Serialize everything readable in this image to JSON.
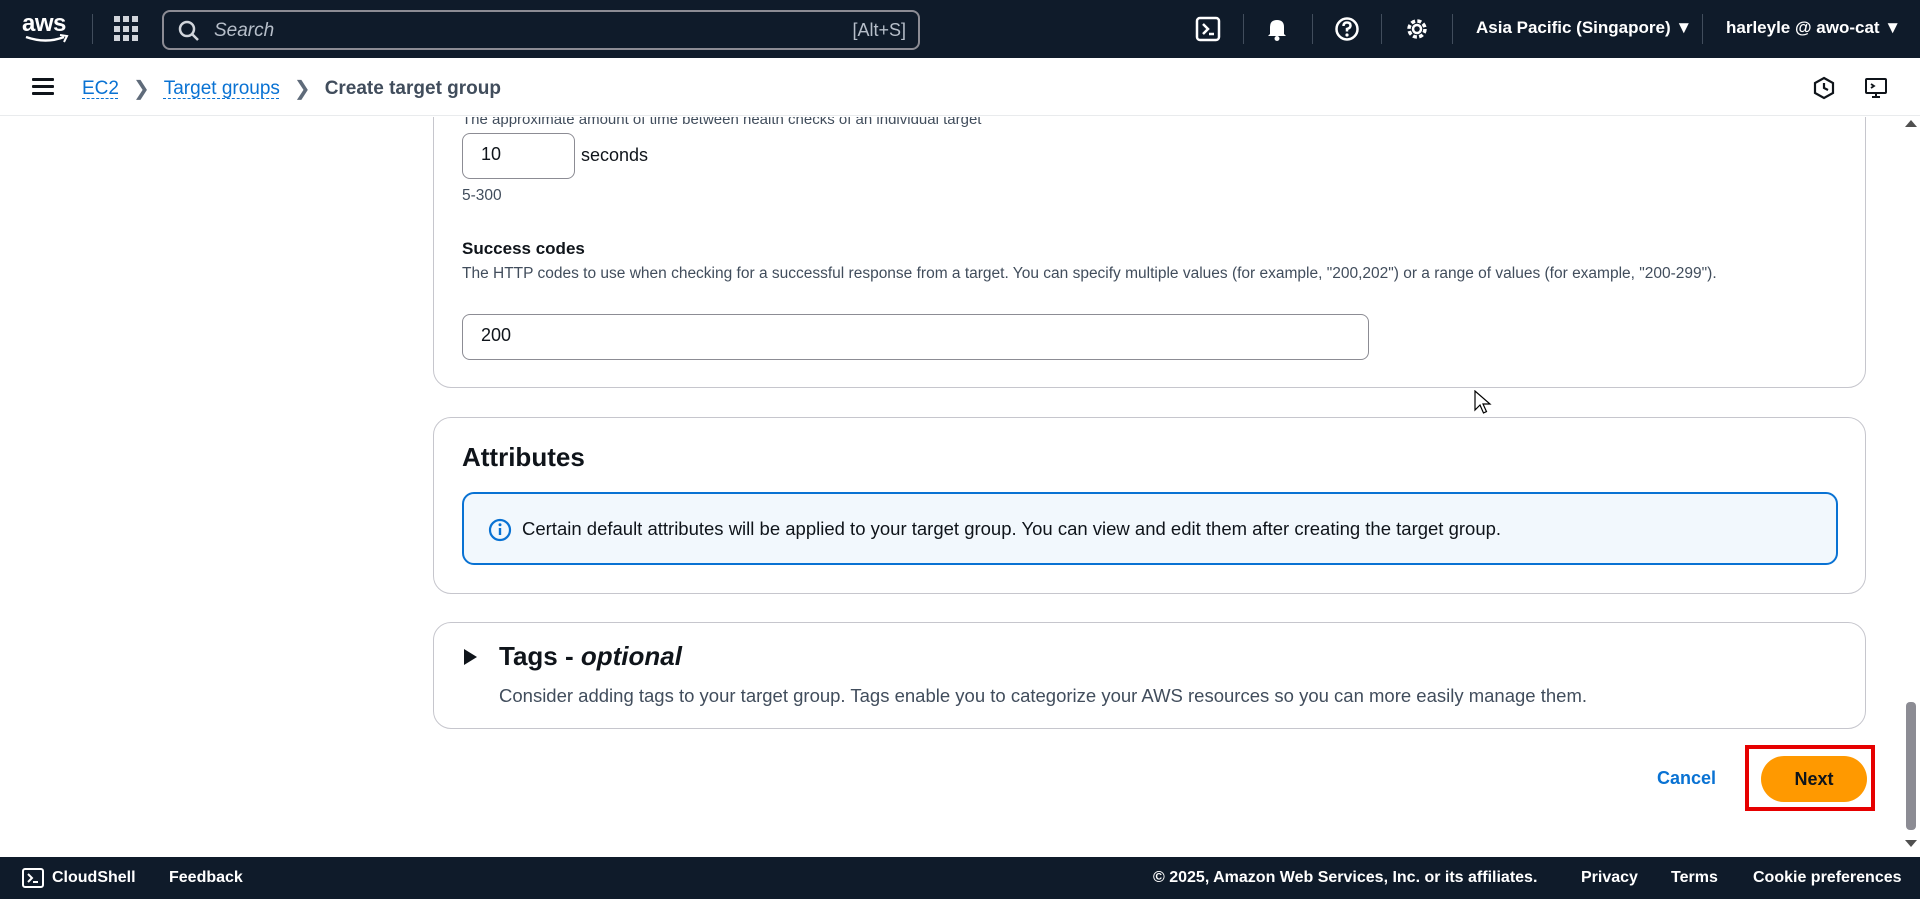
{
  "topnav": {
    "logo_text": "aws",
    "search_placeholder": "Search",
    "search_shortcut": "[Alt+S]",
    "region": "Asia Pacific (Singapore) ▼",
    "user": "harleyle @ awo-cat ▼",
    "icons": [
      "cloudshell-icon",
      "bell-icon",
      "help-icon",
      "gear-icon"
    ]
  },
  "breadcrumb": {
    "items": [
      "EC2",
      "Target groups"
    ],
    "current": "Create target group"
  },
  "health_check": {
    "interval_desc": "The approximate amount of time between health checks of an individual target",
    "interval_value": "10",
    "interval_unit": "seconds",
    "interval_range": "5-300",
    "success_codes_label": "Success codes",
    "success_codes_desc": "The HTTP codes to use when checking for a successful response from a target. You can specify multiple values (for example, \"200,202\") or a range of values (for example, \"200-299\").",
    "success_codes_value": "200"
  },
  "attributes": {
    "title": "Attributes",
    "info": "Certain default attributes will be applied to your target group. You can view and edit them after creating the target group."
  },
  "tags": {
    "title": "Tags - ",
    "title_italic": "optional",
    "desc": "Consider adding tags to your target group. Tags enable you to categorize your AWS resources so you can more easily manage them."
  },
  "actions": {
    "cancel": "Cancel",
    "next": "Next"
  },
  "footer": {
    "cloudshell": "CloudShell",
    "feedback": "Feedback",
    "copyright": "© 2025, Amazon Web Services, Inc. or its affiliates.",
    "privacy": "Privacy",
    "terms": "Terms",
    "cookie": "Cookie preferences"
  },
  "colors": {
    "nav_bg": "#0f1b2a",
    "link": "#0972d3",
    "primary_button": "#ff9900",
    "highlight": "#e60000"
  }
}
